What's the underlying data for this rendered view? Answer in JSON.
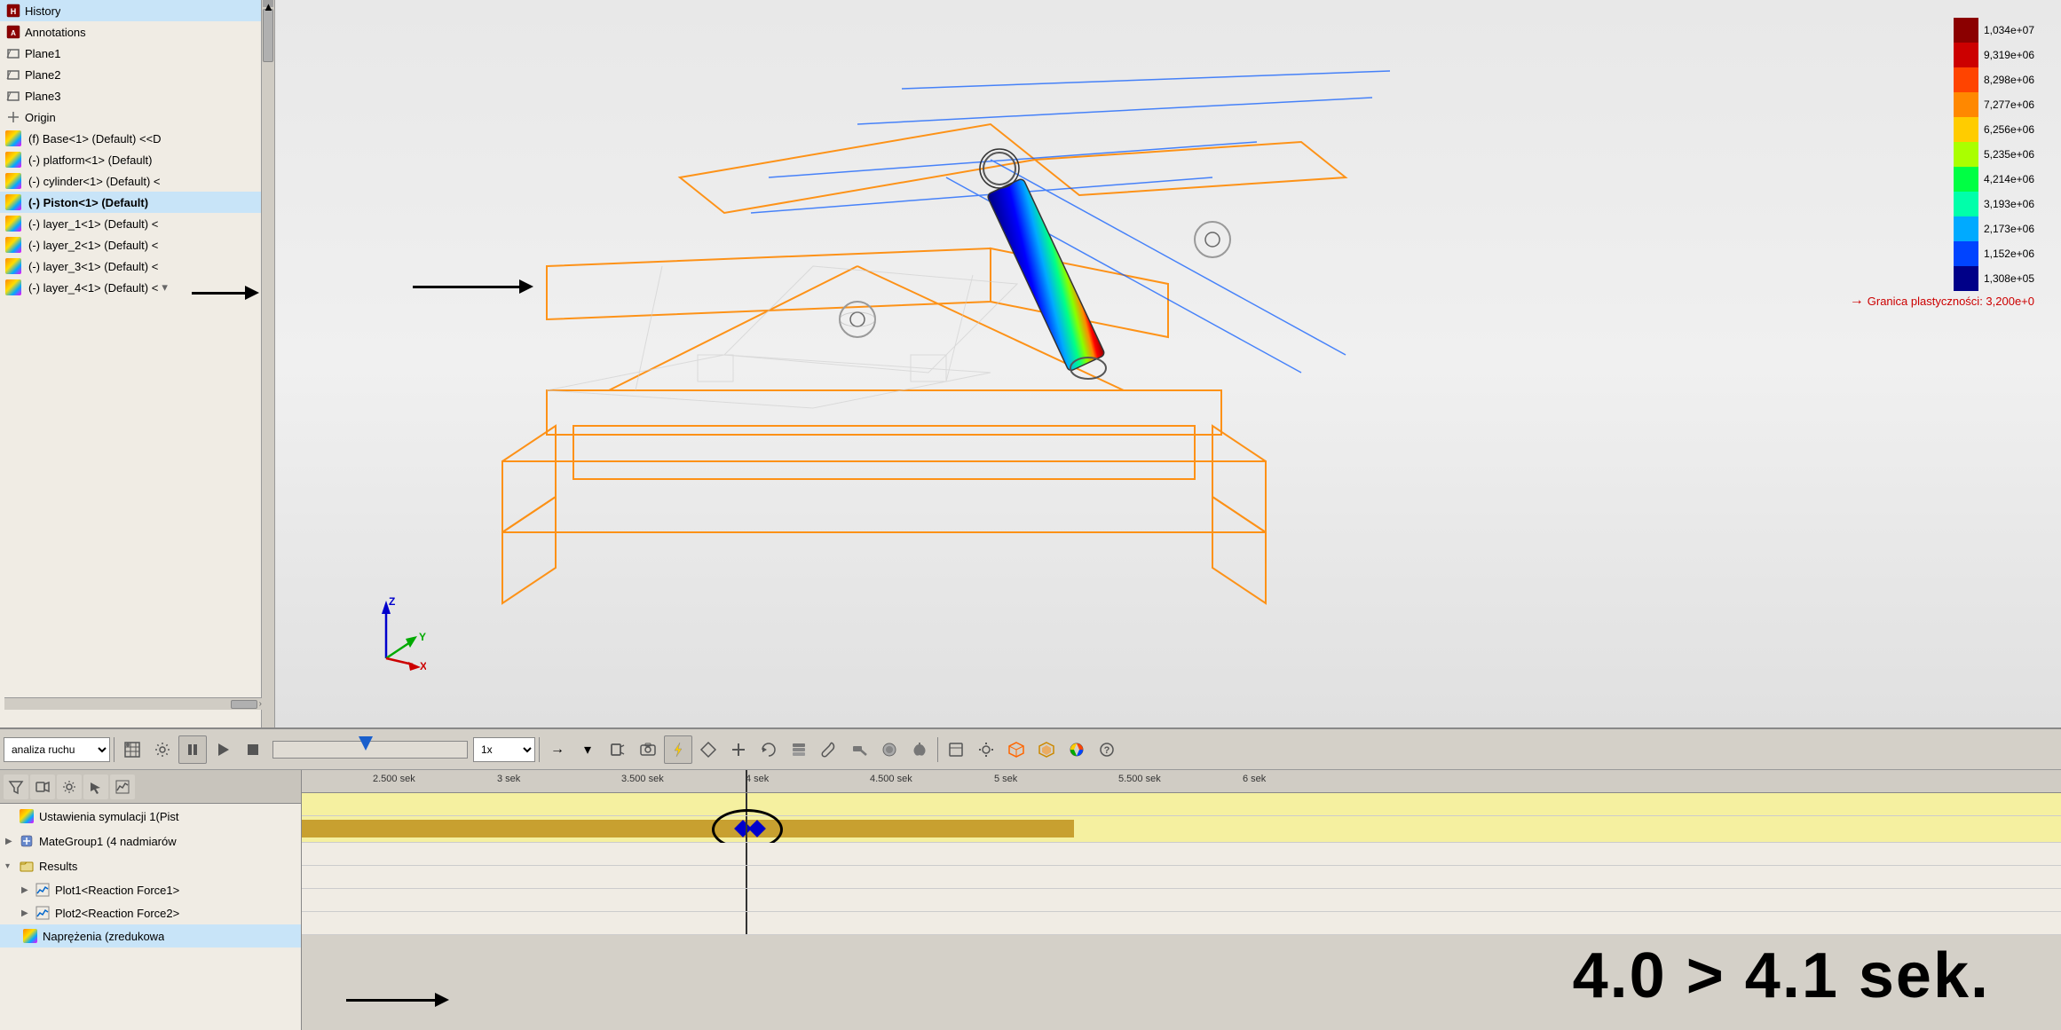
{
  "sidebar": {
    "title": "History",
    "items": [
      {
        "id": "history",
        "label": "History",
        "icon": "history",
        "indent": 0
      },
      {
        "id": "annotations",
        "label": "Annotations",
        "icon": "annotation",
        "indent": 0
      },
      {
        "id": "plane1",
        "label": "Plane1",
        "icon": "plane",
        "indent": 0
      },
      {
        "id": "plane2",
        "label": "Plane2",
        "icon": "plane",
        "indent": 0
      },
      {
        "id": "plane3",
        "label": "Plane3",
        "icon": "plane",
        "indent": 0
      },
      {
        "id": "origin",
        "label": "Origin",
        "icon": "origin",
        "indent": 0
      },
      {
        "id": "base",
        "label": "(f) Base<1> (Default) <<D",
        "icon": "component",
        "indent": 0
      },
      {
        "id": "platform",
        "label": "(-) platform<1> (Default)",
        "icon": "component",
        "indent": 0
      },
      {
        "id": "cylinder",
        "label": "(-) cylinder<1> (Default) <",
        "icon": "component",
        "indent": 0
      },
      {
        "id": "piston",
        "label": "(-) Piston<1> (Default)",
        "icon": "component",
        "indent": 0
      },
      {
        "id": "layer1",
        "label": "(-) layer_1<1> (Default) <",
        "icon": "component",
        "indent": 0
      },
      {
        "id": "layer2",
        "label": "(-) layer_2<1> (Default) <",
        "icon": "component",
        "indent": 0
      },
      {
        "id": "layer3",
        "label": "(-) layer_3<1> (Default) <",
        "icon": "component",
        "indent": 0
      },
      {
        "id": "layer4",
        "label": "(-) layer_4<1> (Default) <",
        "icon": "component",
        "indent": 0
      }
    ]
  },
  "legend": {
    "values": [
      "1,034e+07",
      "9,319e+06",
      "8,298e+06",
      "7,277e+06",
      "6,256e+06",
      "5,235e+06",
      "4,214e+06",
      "3,193e+06",
      "2,173e+06",
      "1,152e+06",
      "1,308e+05"
    ],
    "colors": [
      "#ff0000",
      "#ff4400",
      "#ff8800",
      "#ffcc00",
      "#ccff00",
      "#88ff00",
      "#00ff44",
      "#00ffcc",
      "#0088ff",
      "#0000ff",
      "#000088"
    ],
    "yield_strength": "Granica plastyczności: 3,200e+0"
  },
  "toolbar": {
    "motion_analysis_label": "analiza ruchu",
    "speed_options": [
      "1x"
    ],
    "speed_selected": "1x",
    "buttons": [
      "filter",
      "camera",
      "settings",
      "select",
      "graph"
    ]
  },
  "timeline": {
    "markers": [
      "2.500 sek",
      "3 sek",
      "3.500 sek",
      "4 sek",
      "4.500 sek",
      "5 sek",
      "5.500 sek",
      "6 sek"
    ],
    "current_time_display": "4.0 > 4.1 sek.",
    "tracks": [
      {
        "id": "simulation",
        "label": "Ustawienia symulacji 1(Pist",
        "has_bar": false,
        "type": "yellow"
      },
      {
        "id": "mategroup",
        "label": "MateGroup1 (4 nadmiarów",
        "has_bar": true,
        "type": "gold"
      },
      {
        "id": "results",
        "label": "Results",
        "type": "empty",
        "expanded": true
      },
      {
        "id": "plot1",
        "label": "Plot1<Reaction Force1>",
        "type": "empty"
      },
      {
        "id": "plot2",
        "label": "Plot2<Reaction Force2>",
        "type": "empty"
      },
      {
        "id": "naprezenia",
        "label": "Naprężenia (zredukowa",
        "type": "empty"
      }
    ]
  },
  "axes": {
    "x": "X",
    "y": "Y",
    "z": "Z"
  }
}
